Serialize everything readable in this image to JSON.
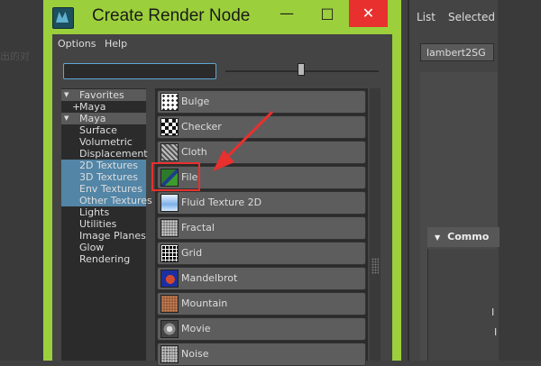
{
  "dialog": {
    "title": "Create Render Node",
    "menu": [
      "Options",
      "Help"
    ],
    "close_icon": "close-icon",
    "search_placeholder": ""
  },
  "tree": [
    {
      "label": "Favorites",
      "kind": "header",
      "marker": "triangle-down-icon"
    },
    {
      "label": "Maya",
      "kind": "item",
      "prefix": "+"
    },
    {
      "label": "Maya",
      "kind": "header",
      "marker": "triangle-down-icon"
    },
    {
      "label": "Surface",
      "kind": "item"
    },
    {
      "label": "Volumetric",
      "kind": "item"
    },
    {
      "label": "Displacement",
      "kind": "item"
    },
    {
      "label": "2D Textures",
      "kind": "selected"
    },
    {
      "label": "3D Textures",
      "kind": "selected"
    },
    {
      "label": "Env Textures",
      "kind": "selected"
    },
    {
      "label": "Other Textures",
      "kind": "selected"
    },
    {
      "label": "Lights",
      "kind": "item"
    },
    {
      "label": "Utilities",
      "kind": "item"
    },
    {
      "label": "Image Planes",
      "kind": "item"
    },
    {
      "label": "Glow",
      "kind": "item"
    },
    {
      "label": "Rendering",
      "kind": "item"
    }
  ],
  "nodes": [
    {
      "label": "Bulge",
      "icon": "bulge-icon"
    },
    {
      "label": "Checker",
      "icon": "checker-icon"
    },
    {
      "label": "Cloth",
      "icon": "cloth-icon"
    },
    {
      "label": "File",
      "icon": "file-icon"
    },
    {
      "label": "Fluid Texture 2D",
      "icon": "fluid-texture-icon"
    },
    {
      "label": "Fractal",
      "icon": "fractal-icon"
    },
    {
      "label": "Grid",
      "icon": "grid-icon"
    },
    {
      "label": "Mandelbrot",
      "icon": "mandelbrot-icon"
    },
    {
      "label": "Mountain",
      "icon": "mountain-icon"
    },
    {
      "label": "Movie",
      "icon": "movie-icon"
    },
    {
      "label": "Noise",
      "icon": "noise-icon"
    }
  ],
  "background": {
    "left_text": "出的对",
    "menu": [
      "List",
      "Selected"
    ],
    "field_value": "lambert2SG",
    "section_title": "Commo",
    "letters": [
      "I",
      "I"
    ]
  },
  "annotation": {
    "highlighted_node": "File",
    "color": "#e8302e"
  },
  "colors": {
    "dialog_frame": "#9ccf3c",
    "selection": "#5285a6",
    "close_button": "#e8302e"
  }
}
